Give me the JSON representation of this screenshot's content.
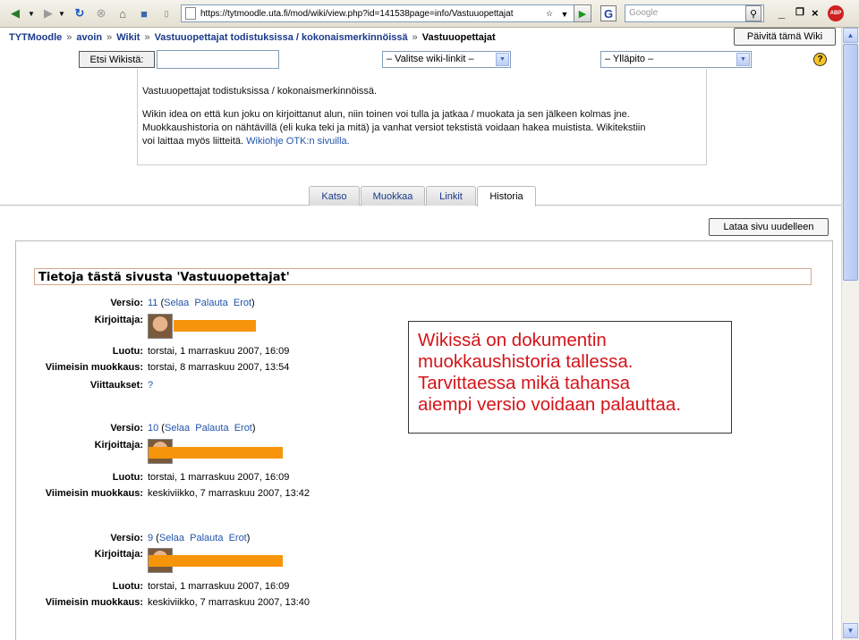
{
  "browser": {
    "url": "https://tytmoodle.uta.fi/mod/wiki/view.php?id=141538page=info/Vastuuopettajat",
    "search_placeholder": "Google",
    "google_letter": "G",
    "abp_label": "ABP",
    "window_controls": [
      "_",
      "×"
    ],
    "window_restore": "¢"
  },
  "breadcrumb": {
    "items": [
      "TYTMoodle",
      "avoin",
      "Wikit",
      "Vastuuopettajat todistuksissa / kokonaismerkinnöissä",
      "Vastuuopettajat"
    ],
    "separator": "»"
  },
  "header": {
    "update_button": "Päivitä tämä Wiki"
  },
  "search_row": {
    "search_label": "Etsi Wikistä:",
    "wiki_links_select": "– Valitse wiki-linkit –",
    "admin_select": "– Ylläpito –",
    "help_label": "?"
  },
  "intro": {
    "title": "Vastuuopettajat todistuksissa / kokonaismerkinnöissä.",
    "line1": "Wikin idea on että kun joku on kirjoittanut alun, niin toinen voi tulla ja jatkaa / muokata ja sen jälkeen kolmas jne.",
    "line2": "Muokkaushistoria on nähtävillä (eli kuka teki ja mitä) ja vanhat versiot tekstistä voidaan hakea muistista. Wikitekstiin",
    "line3": "voi laittaa myös liitteitä.",
    "link": "Wikiohje OTK:n sivuilla."
  },
  "tabs": [
    "Katso",
    "Muokkaa",
    "Linkit",
    "Historia"
  ],
  "reload_button": "Lataa sivu uudelleen",
  "info_header": "Tietoja tästä sivusta 'Vastuuopettajat'",
  "labels": {
    "version": "Versio:",
    "author": "Kirjoittaja:",
    "created": "Luotu:",
    "last_modified": "Viimeisin muokkaus:",
    "references": "Viittaukset:"
  },
  "version_links": {
    "view": "Selaa",
    "restore": "Palauta",
    "diff": "Erot"
  },
  "versions": [
    {
      "number": "11",
      "created": "torstai, 1 marraskuu 2007, 16:09",
      "modified": "torstai, 8 marraskuu 2007, 13:54",
      "references": "?"
    },
    {
      "number": "10",
      "created": "torstai, 1 marraskuu 2007, 16:09",
      "modified": "keskiviikko, 7 marraskuu 2007, 13:42"
    },
    {
      "number": "9",
      "created": "torstai, 1 marraskuu 2007, 16:09",
      "modified": "keskiviikko, 7 marraskuu 2007, 13:40"
    }
  ],
  "callout": {
    "line1": "Wikissä on dokumentin",
    "line2": "muokkaushistoria tallessa.",
    "line3": "Tarvittaessa mikä tahansa",
    "line4": "aiempi versio voidaan palauttaa."
  }
}
